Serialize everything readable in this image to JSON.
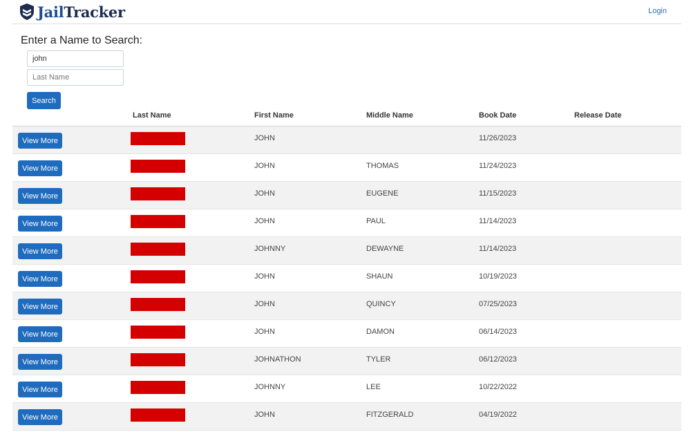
{
  "brand": {
    "name_part1": "Jail",
    "name_part2": "Tracker",
    "logo_color": "#1d2d4f",
    "accent_color": "#1d4e8f"
  },
  "header": {
    "login_label": "Login"
  },
  "search": {
    "label": "Enter a Name to Search:",
    "first_name_value": "john",
    "last_name_placeholder": "Last Name",
    "button_label": "Search"
  },
  "table": {
    "columns": [
      "Last Name",
      "First Name",
      "Middle Name",
      "Book Date",
      "Release Date"
    ],
    "view_more_label": "View More",
    "redaction_color": "#d40000",
    "rows": [
      {
        "first": "JOHN",
        "middle": "",
        "book_date": "11/26/2023",
        "release_date": ""
      },
      {
        "first": "JOHN",
        "middle": "THOMAS",
        "book_date": "11/24/2023",
        "release_date": ""
      },
      {
        "first": "JOHN",
        "middle": "EUGENE",
        "book_date": "11/15/2023",
        "release_date": ""
      },
      {
        "first": "JOHN",
        "middle": "PAUL",
        "book_date": "11/14/2023",
        "release_date": ""
      },
      {
        "first": "JOHNNY",
        "middle": "DEWAYNE",
        "book_date": "11/14/2023",
        "release_date": ""
      },
      {
        "first": "JOHN",
        "middle": "SHAUN",
        "book_date": "10/19/2023",
        "release_date": ""
      },
      {
        "first": "JOHN",
        "middle": "QUINCY",
        "book_date": "07/25/2023",
        "release_date": ""
      },
      {
        "first": "JOHN",
        "middle": "DAMON",
        "book_date": "06/14/2023",
        "release_date": ""
      },
      {
        "first": "JOHNATHON",
        "middle": "TYLER",
        "book_date": "06/12/2023",
        "release_date": ""
      },
      {
        "first": "JOHNNY",
        "middle": "LEE",
        "book_date": "10/22/2022",
        "release_date": ""
      },
      {
        "first": "JOHN",
        "middle": "FITZGERALD",
        "book_date": "04/19/2022",
        "release_date": ""
      }
    ]
  }
}
